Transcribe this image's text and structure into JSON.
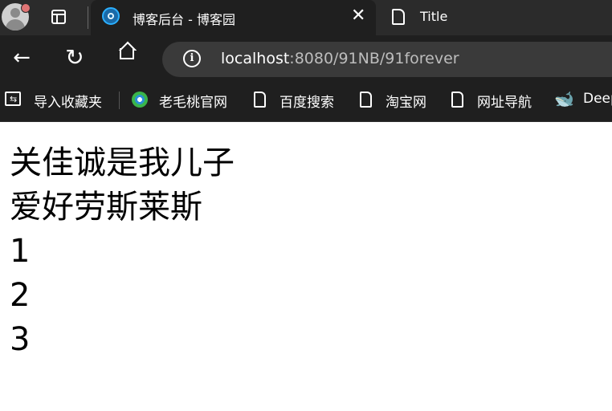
{
  "browser": {
    "tabs": [
      {
        "title": "博客后台 - 博客园",
        "active": true,
        "close_label": "✕"
      },
      {
        "title": "Title",
        "active": false
      }
    ],
    "address_bar": {
      "host": "localhost",
      "rest": ":8080/91NB/91forever"
    },
    "bookmarks": [
      {
        "label": "导入收藏夹",
        "icon": "import-favorites-icon"
      },
      {
        "label": "老毛桃官网",
        "icon": "globe-icon"
      },
      {
        "label": "百度搜索",
        "icon": "page-icon"
      },
      {
        "label": "淘宝网",
        "icon": "page-icon"
      },
      {
        "label": "网址导航",
        "icon": "page-icon"
      },
      {
        "label": "Deep",
        "icon": "whale-icon"
      }
    ],
    "icons": {
      "back": "←",
      "reload": "↻",
      "info": "i"
    }
  },
  "page": {
    "lines": [
      "关佳诚是我儿子",
      "爱好劳斯莱斯",
      "1",
      "2",
      "3"
    ]
  }
}
